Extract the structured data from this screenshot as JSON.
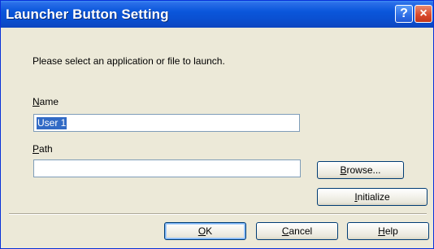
{
  "window": {
    "title": "Launcher Button Setting",
    "help_glyph": "?",
    "close_glyph": "×"
  },
  "prompt": "Please select an application or file to launch.",
  "name_field": {
    "label_mnemonic": "N",
    "label_rest": "ame",
    "value": "User 1"
  },
  "path_field": {
    "label_mnemonic": "P",
    "label_rest": "ath",
    "value": ""
  },
  "buttons": {
    "browse_mnemonic": "B",
    "browse_rest": "rowse...",
    "initialize_mnemonic": "I",
    "initialize_rest": "nitialize",
    "ok_mnemonic": "O",
    "ok_rest": "K",
    "cancel_mnemonic": "C",
    "cancel_rest": "ancel",
    "help_mnemonic": "H",
    "help_rest": "elp"
  },
  "colors": {
    "title_bar": "#0a56db",
    "face": "#ece9d8",
    "selection": "#316ac5"
  }
}
